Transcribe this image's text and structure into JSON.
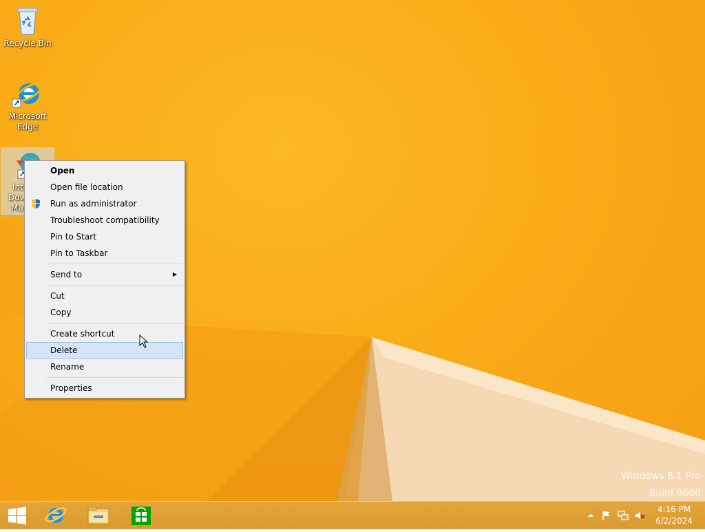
{
  "desktop": {
    "icons": [
      {
        "label": "Recycle Bin"
      },
      {
        "label_lines": [
          "Microsoft",
          "Edge"
        ]
      },
      {
        "label_lines": [
          "Inte",
          "Dow",
          "Ma"
        ]
      }
    ]
  },
  "context_menu": {
    "items": {
      "open": "Open",
      "open_file_location": "Open file location",
      "run_as_admin": "Run as administrator",
      "troubleshoot": "Troubleshoot compatibility",
      "pin_start": "Pin to Start",
      "pin_taskbar": "Pin to Taskbar",
      "send_to": "Send to",
      "cut": "Cut",
      "copy": "Copy",
      "create_shortcut": "Create shortcut",
      "delete": "Delete",
      "rename": "Rename",
      "properties": "Properties"
    },
    "highlighted": "delete"
  },
  "watermark": {
    "line1": "Windows 8.1 Pro",
    "line2": "Build 9600"
  },
  "taskbar": {
    "pinned_icons": [
      "windows-logo-icon",
      "internet-explorer-icon",
      "file-explorer-icon",
      "store-icon"
    ],
    "tray_icons": [
      "show-hidden-icons-icon",
      "action-center-flag-icon",
      "network-icon",
      "volume-muted-icon"
    ],
    "clock": {
      "time": "4:16 PM",
      "date": "6/2/2024"
    }
  },
  "colors": {
    "wallpaper": "#f9ac18",
    "taskbar": "#df9f35",
    "menu_highlight": "#d5e5f7"
  }
}
